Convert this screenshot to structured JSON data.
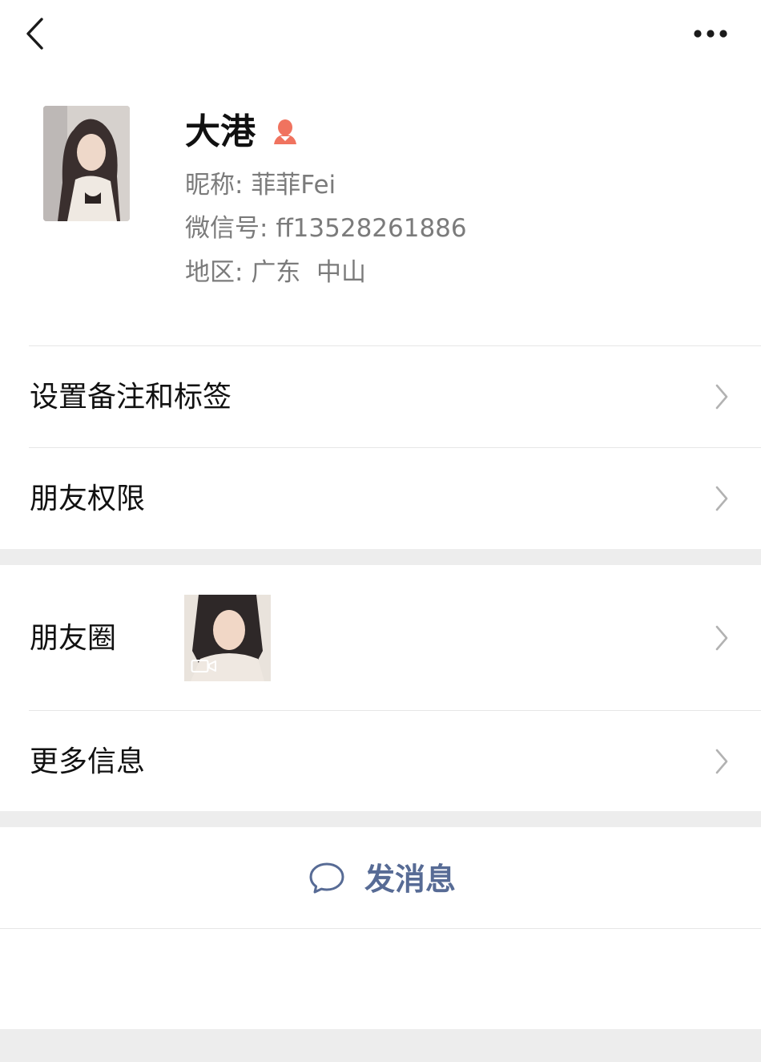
{
  "nav": {
    "back_icon": "chevron-left-icon",
    "more_icon": "ellipsis-icon"
  },
  "profile": {
    "display_name": "大港",
    "gender_icon": "female-icon",
    "gender_color": "#fa5151",
    "nickname_label": "昵称:",
    "nickname": "菲菲Fei",
    "wechat_id_label": "微信号:",
    "wechat_id": "ff13528261886",
    "region_label": "地区:",
    "region": "广东  中山"
  },
  "menu": {
    "remarks_tags": "设置备注和标签",
    "friend_permissions": "朋友权限",
    "moments": "朋友圈",
    "more_info": "更多信息"
  },
  "actions": {
    "send_message": "发消息",
    "send_message_icon": "chat-bubble-icon",
    "accent_color": "#576b95"
  }
}
